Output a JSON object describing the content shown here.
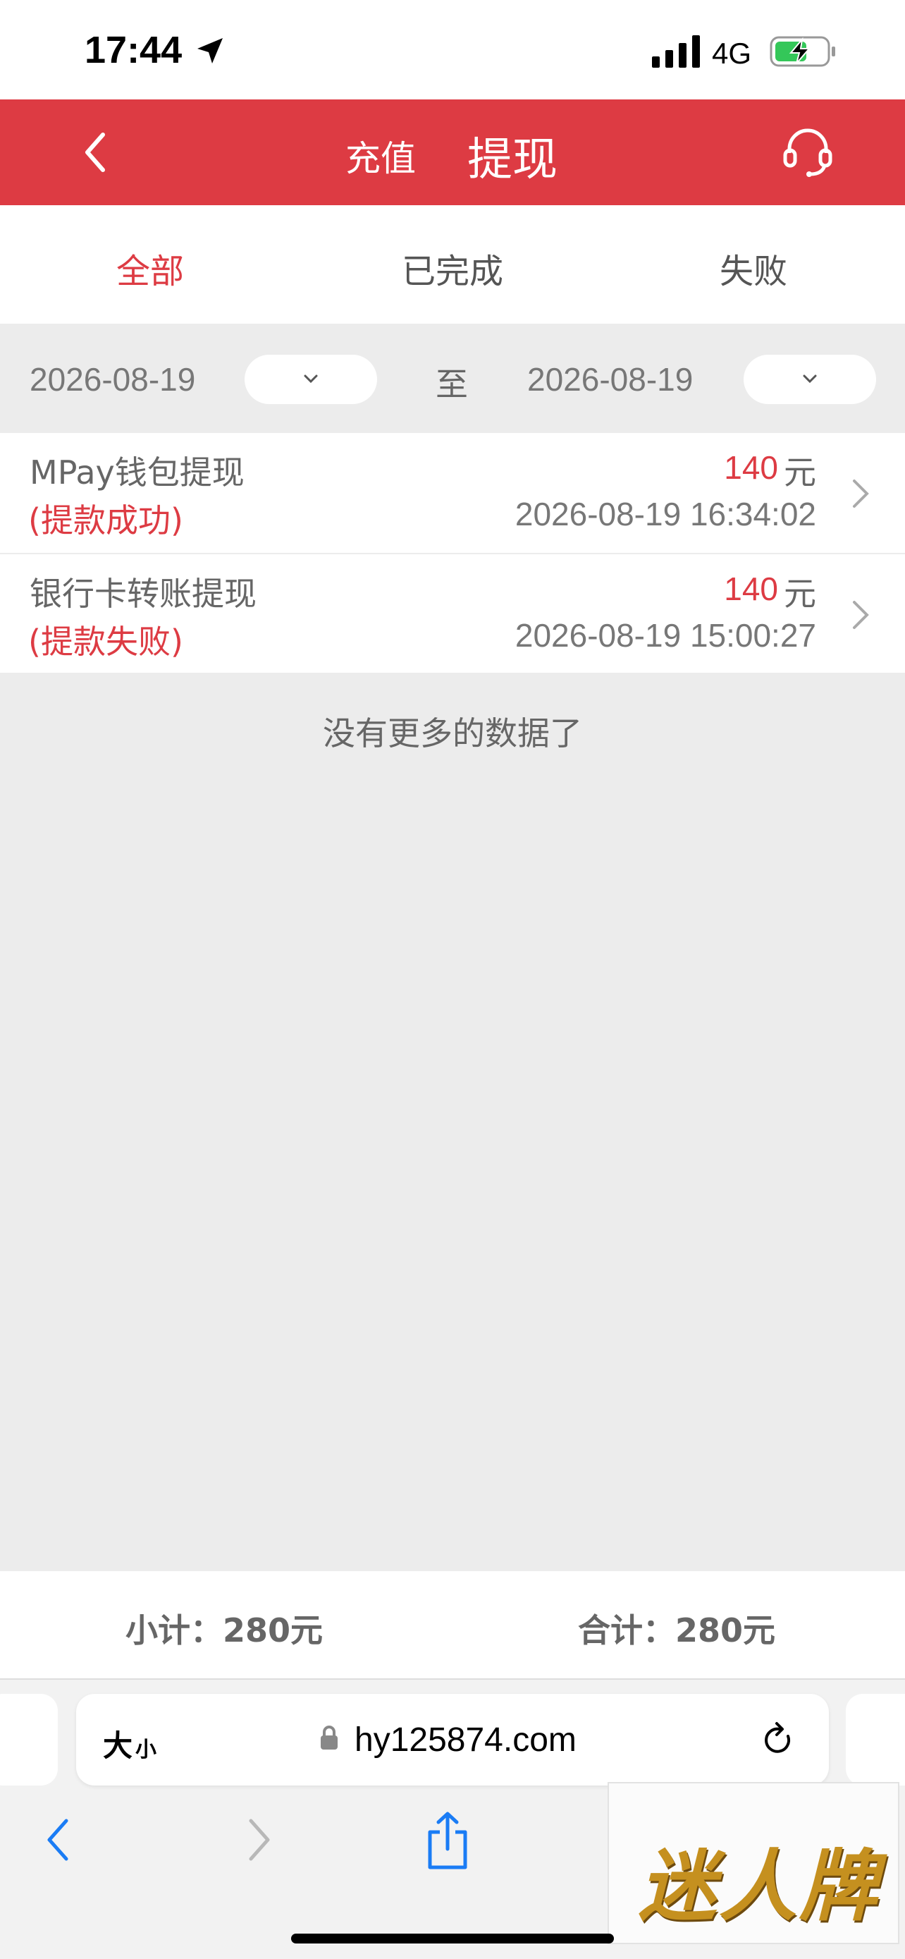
{
  "status_bar": {
    "time": "17:44",
    "network": "4G"
  },
  "nav": {
    "tab_recharge": "充值",
    "tab_withdraw": "提现"
  },
  "filter_tabs": [
    "全部",
    "已完成",
    "失败"
  ],
  "date_filter": {
    "start": "2026-08-19",
    "separator": "至",
    "end": "2026-08-19"
  },
  "records": [
    {
      "title": "MPay钱包提现",
      "status": "(提款成功)",
      "amount": "140",
      "unit": "元",
      "time": "2026-08-19 16:34:02"
    },
    {
      "title": "银行卡转账提现",
      "status": "(提款失败)",
      "amount": "140",
      "unit": "元",
      "time": "2026-08-19 15:00:27"
    }
  ],
  "no_more_text": "没有更多的数据了",
  "totals": {
    "subtotal": "小计：280元",
    "total": "合计：280元"
  },
  "browser": {
    "text_size_big": "大",
    "text_size_small": "小",
    "url": "hy125874.com"
  },
  "overlay_logo": "迷人牌",
  "colors": {
    "accent": "#dd3b43",
    "background": "#ececec"
  }
}
